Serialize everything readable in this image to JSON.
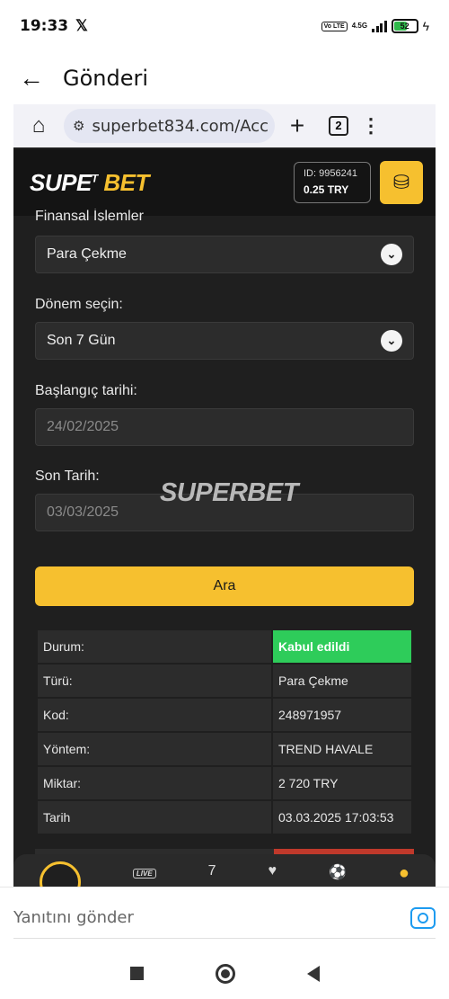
{
  "status_bar": {
    "time": "19:33",
    "x_logo": "𝕏",
    "volte": "VoLTE",
    "network": "4.5G",
    "battery": "52"
  },
  "app_header": {
    "back_icon": "←",
    "title": "Gönderi"
  },
  "browser": {
    "home_icon": "⌂",
    "url": "superbet834.com/Acc",
    "plus_icon": "+",
    "tab_count": "2",
    "menu_icon": "⋮"
  },
  "site": {
    "logo_white": "SUPE",
    "logo_yellow": "BET",
    "logo_sup": "T",
    "account_id": "ID: 9956241",
    "balance": "0.25 TRY"
  },
  "form": {
    "section_label": "Finansal İşlemler",
    "transaction_type": "Para Çekme",
    "period_label": "Dönem seçin:",
    "period_value": "Son 7 Gün",
    "start_label": "Başlangıç tarihi:",
    "start_value": "24/02/2025",
    "end_label": "Son Tarih:",
    "end_value": "03/03/2025",
    "search_button": "Ara"
  },
  "watermark": "SUPERBET",
  "result_table": [
    {
      "key": "Durum:",
      "value": "Kabul edildi"
    },
    {
      "key": "Türü:",
      "value": "Para Çekme"
    },
    {
      "key": "Kod:",
      "value": "248971957"
    },
    {
      "key": "Yöntem:",
      "value": "TREND HAVALE"
    },
    {
      "key": "Miktar:",
      "value": "2 720 TRY"
    },
    {
      "key": "Tarih",
      "value": "03.03.2025 17:03:53"
    }
  ],
  "bottom_nav": {
    "live": "LIVE",
    "seven": "7"
  },
  "reply": {
    "placeholder": "Yanıtını gönder"
  },
  "colors": {
    "accent": "#f6c02f",
    "success": "#2ecc5a",
    "twitter_blue": "#1d9bf0"
  }
}
